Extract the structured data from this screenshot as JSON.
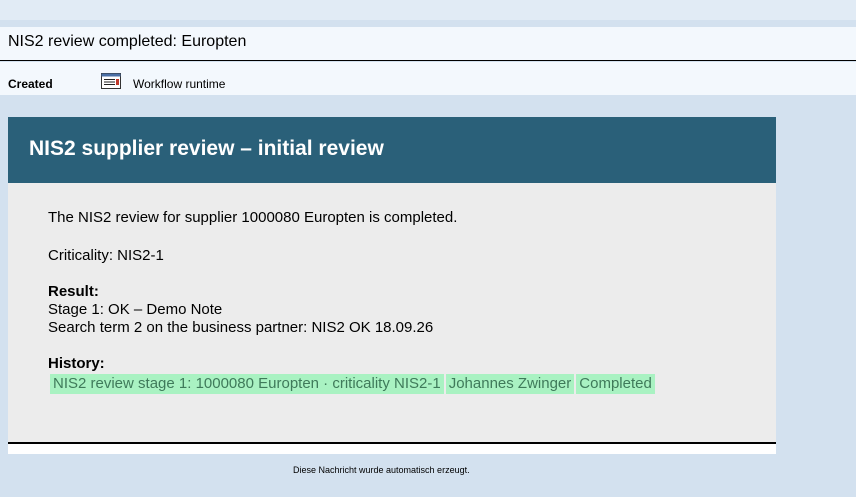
{
  "header": {
    "title": "NIS2 review completed: Europten"
  },
  "meta": {
    "status": "Created",
    "source_icon": "document-icon",
    "source": "Workflow runtime"
  },
  "card": {
    "heading": "NIS2 supplier review – initial review",
    "intro": "The NIS2 review for supplier 1000080 Europten is completed.",
    "criticality": "Criticality: NIS2-1",
    "result": {
      "label": "Result:",
      "lines": [
        "Stage 1: OK – Demo Note",
        "Search term 2 on the business partner: NIS2 OK 18.09.26"
      ]
    },
    "history": {
      "label": "History:",
      "rows": [
        {
          "step": "NIS2 review stage 1: 1000080 Europten · criticality NIS2-1",
          "user": "Johannes Zwinger",
          "state": "Completed"
        }
      ]
    }
  },
  "footer": {
    "note": "Diese Nachricht wurde automatisch erzeugt."
  },
  "colors": {
    "header_bg": "#2a6079",
    "history_bg": "#a9f2c2",
    "page_bg": "#d3e1ef"
  }
}
